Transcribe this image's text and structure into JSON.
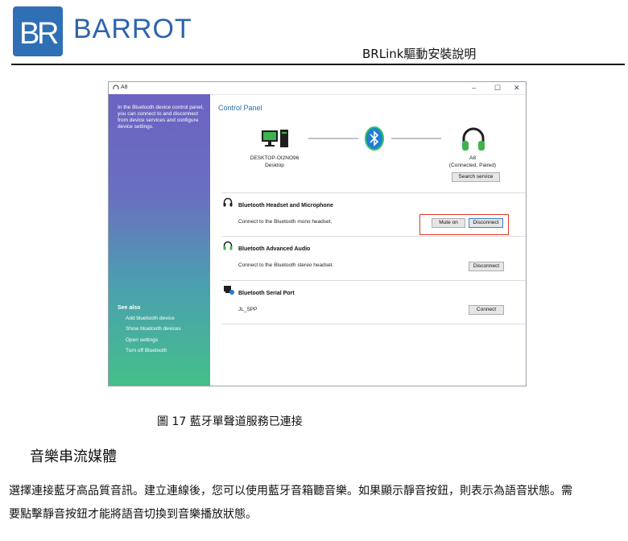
{
  "header": {
    "brand": "BARROT",
    "doc_title": "BRLink驅動安裝說明"
  },
  "dialog": {
    "window_title": "A8",
    "window_controls": {
      "minimize": "–",
      "maximize": "☐",
      "close": "✕"
    },
    "sidebar": {
      "intro": "In the Bluetooth device control panel, you can connect to and disconnect from device services and configure device settings.",
      "see_also_title": "See also",
      "links": [
        "Add bluetooth device",
        "Show bluetooth devices",
        "Open settings",
        "Turn off Bluetooth"
      ]
    },
    "panel_title": "Control Panel",
    "computer": {
      "name": "DESKTOP-OI2NO96",
      "type": "Desktop"
    },
    "headset": {
      "name": "A8",
      "status": "(Connected, Paired)"
    },
    "search_service_label": "Search service",
    "services": [
      {
        "name": "Bluetooth Headset and Microphone",
        "desc": "Connect to the Bluetooth mono headset.",
        "buttons": [
          "Mute on",
          "Disconnect"
        ]
      },
      {
        "name": "Bluetooth Advanced Audio",
        "desc": "Connect to the Bluetooth stereo headset.",
        "buttons": [
          "Disconnect"
        ]
      },
      {
        "name": "Bluetooth Serial Port",
        "desc": "JL_SPP",
        "buttons": [
          "Connect"
        ]
      }
    ],
    "colors": {
      "highlight": "#e03b2a",
      "panel_title": "#2a6ea8",
      "headset_green": "#3fb34f"
    }
  },
  "caption": "圖 17 藍牙單聲道服務已連接",
  "section_title": "音樂串流媒體",
  "paragraph_line1": "選擇連接藍牙高品質音訊。建立連線後，您可以使用藍牙音箱聽音樂。如果顯示靜音按鈕，則表示為語音狀態。需",
  "paragraph_line2": "要點擊靜音按鈕才能將語音切換到音樂播放狀態。"
}
